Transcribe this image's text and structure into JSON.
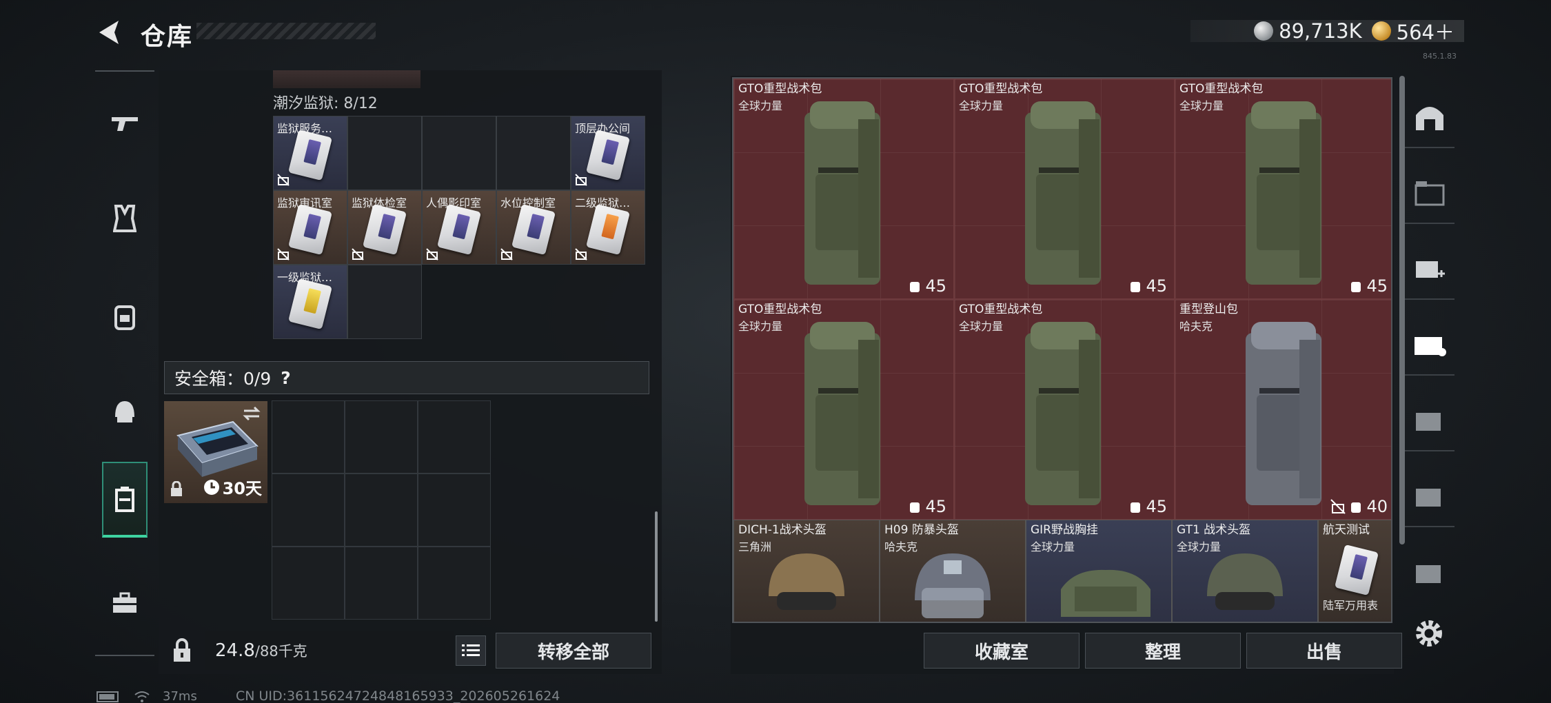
{
  "header": {
    "title": "仓库",
    "currency": [
      {
        "icon": "silver-coin-icon",
        "value": "89,713K"
      },
      {
        "icon": "gold-coin-icon",
        "value": "564＋"
      }
    ],
    "version": "845.1.83"
  },
  "left_nav": [
    "gun-icon",
    "armor-vest-icon",
    "backpack-icon",
    "helmet-icon",
    "safebox-icon",
    "toolbox-icon"
  ],
  "region": {
    "label": "潮汐监狱: 8/12",
    "cards": [
      {
        "label": "监狱服务…",
        "color": "purple"
      },
      {
        "label": "",
        "color": ""
      },
      {
        "label": "",
        "color": ""
      },
      {
        "label": "",
        "color": ""
      },
      {
        "label": "顶层办公间",
        "color": "purple"
      },
      {
        "label": "监狱审讯室",
        "color": "purple"
      },
      {
        "label": "监狱体检室",
        "color": "purple"
      },
      {
        "label": "人偶影印室",
        "color": "purple"
      },
      {
        "label": "水位控制室",
        "color": "purple"
      },
      {
        "label": "二级监狱…",
        "color": "orange"
      },
      {
        "label": "一级监狱…",
        "color": "yellow"
      }
    ]
  },
  "safebox": {
    "label": "安全箱：0/9",
    "help": "?",
    "duration": "30天"
  },
  "weight": {
    "current": "24.8",
    "total": "/88千克"
  },
  "buttons": {
    "transfer_all": "转移全部",
    "collection_room": "收藏室",
    "organize": "整理",
    "sell": "出售"
  },
  "stash": {
    "backpacks": [
      {
        "name": "GTO重型战术包",
        "brand": "全球力量",
        "capacity": "45",
        "color": "green"
      },
      {
        "name": "GTO重型战术包",
        "brand": "全球力量",
        "capacity": "45",
        "color": "green"
      },
      {
        "name": "GTO重型战术包",
        "brand": "全球力量",
        "capacity": "45",
        "color": "green"
      },
      {
        "name": "GTO重型战术包",
        "brand": "全球力量",
        "capacity": "45",
        "color": "green"
      },
      {
        "name": "GTO重型战术包",
        "brand": "全球力量",
        "capacity": "45",
        "color": "green"
      },
      {
        "name": "重型登山包",
        "brand": "哈夫克",
        "capacity": "40",
        "color": "gray"
      }
    ],
    "gear": [
      {
        "name": "DICH-1战术头盔",
        "brand": "三角洲"
      },
      {
        "name": "H09 防暴头盔",
        "brand": "哈夫克"
      },
      {
        "name": "GIR野战胸挂",
        "brand": "全球力量"
      },
      {
        "name": "GT1 战术头盔",
        "brand": "全球力量"
      },
      {
        "name": "航天测试",
        "brand": "陆军万用表"
      }
    ]
  },
  "status": {
    "ping": "37ms",
    "uid": "CN UID:361156247248481659​33_202605261624"
  }
}
